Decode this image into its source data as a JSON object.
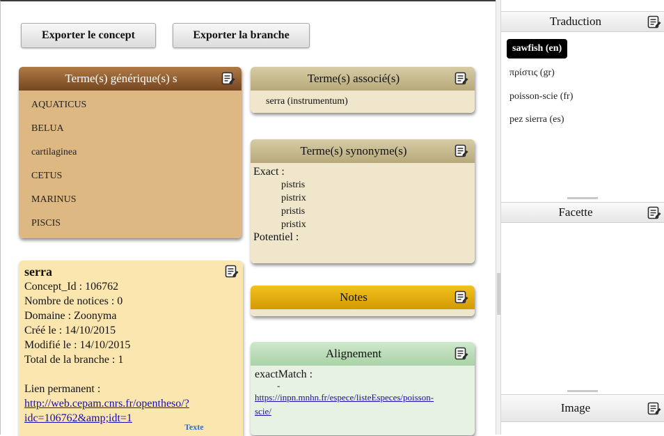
{
  "toolbar": {
    "export_concept": "Exporter le concept",
    "export_branch": "Exporter la branche"
  },
  "generic": {
    "title": "Terme(s) générique(s) s",
    "items": [
      "AQUATICUS",
      "BELUA",
      "cartilaginea",
      "CETUS",
      "MARINUS",
      "PISCIS"
    ]
  },
  "associated": {
    "title": "Terme(s) associé(s)",
    "items": [
      "serra (instrumentum)"
    ]
  },
  "synonyms": {
    "title": "Terme(s) synonyme(s)",
    "exact_label": "Exact :",
    "exact_items": [
      "pistris",
      "pistrix",
      "pristis",
      "pristix"
    ],
    "potential_label": "Potentiel :"
  },
  "notes": {
    "title": "Notes"
  },
  "alignment": {
    "title": "Alignement",
    "match_label": "exactMatch :",
    "dash": "-",
    "link_line1": "https://inpn.mnhn.fr/espece/listeEspeces/poisson-",
    "link_line2": "scie/"
  },
  "concept": {
    "name": "serra",
    "id": "Concept_Id : 106762",
    "notices": "Nombre de notices : 0",
    "domain": "Domaine : Zoonyma",
    "created": "Créé le : 14/10/2015",
    "modified": "Modifié le : 14/10/2015",
    "branch_total": "Total de la branche : 1",
    "permalink_label": "Lien permanent :",
    "permalink_line1": "http://web.cepam.cnrs.fr/opentheso/?",
    "permalink_line2": "idc=106762&amp;idt=1",
    "text_link": "Texte"
  },
  "sidebar": {
    "translation_title": "Traduction",
    "translations": [
      "sawfish (en)",
      "πρίστις (gr)",
      "poisson-scie (fr)",
      "pez sierra (es)"
    ],
    "facet_title": "Facette",
    "image_title": "Image"
  },
  "colors": {
    "generic_header": "#754620",
    "generic_body": "#ddb883",
    "tan_header": "#b8a97a",
    "notes_header": "#d39a05",
    "alignment_header": "#a9d2a6",
    "concept_body": "#fbe6b0",
    "link": "#1a0dab"
  }
}
